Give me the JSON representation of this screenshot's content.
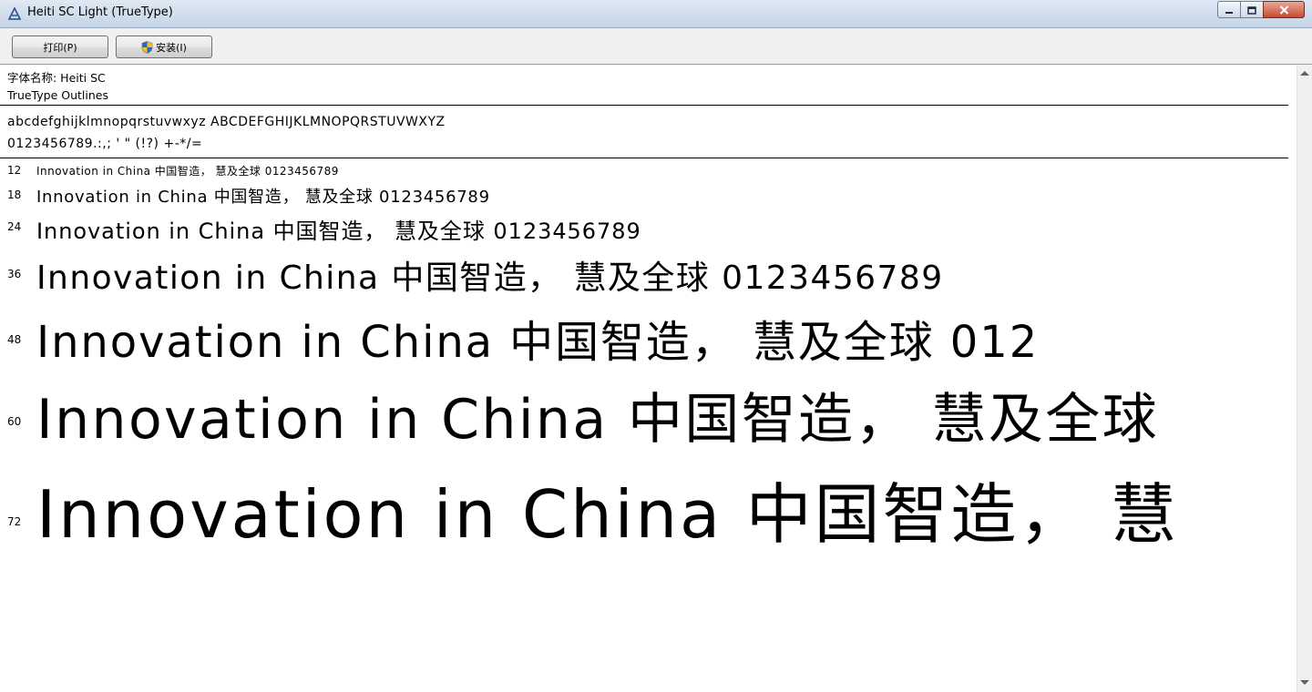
{
  "window": {
    "title": "Heiti SC Light (TrueType)"
  },
  "toolbar": {
    "print_label": "打印(P)",
    "install_label": "安装(I)"
  },
  "font_info": {
    "name_line": "字体名称: Heiti SC",
    "outline_line": "TrueType Outlines"
  },
  "glyph_preview": {
    "line1": "abcdefghijklmnopqrstuvwxyz  ABCDEFGHIJKLMNOPQRSTUVWXYZ",
    "line2": "0123456789.:,;  '  \"  (!?)  +-*/="
  },
  "samples": [
    {
      "size": "12",
      "text": "Innovation  in  China  中国智造， 慧及全球  0123456789"
    },
    {
      "size": "18",
      "text": "Innovation  in  China  中国智造， 慧及全球  0123456789"
    },
    {
      "size": "24",
      "text": "Innovation  in  China  中国智造， 慧及全球  0123456789"
    },
    {
      "size": "36",
      "text": "Innovation  in  China  中国智造， 慧及全球  0123456789"
    },
    {
      "size": "48",
      "text": "Innovation  in  China  中国智造， 慧及全球  012"
    },
    {
      "size": "60",
      "text": "Innovation  in  China  中国智造， 慧及全球"
    },
    {
      "size": "72",
      "text": "Innovation  in  China  中国智造， 慧"
    }
  ],
  "colors": {
    "titlebar_top": "#dfe8f3",
    "titlebar_bottom": "#c5d4e6",
    "close_button": "#c74a2f",
    "content_bg": "#ffffff"
  },
  "icons": {
    "app": "font-viewer-icon",
    "install": "uac-shield-icon",
    "minimize": "minimize-icon",
    "maximize": "maximize-icon",
    "close": "close-icon"
  }
}
